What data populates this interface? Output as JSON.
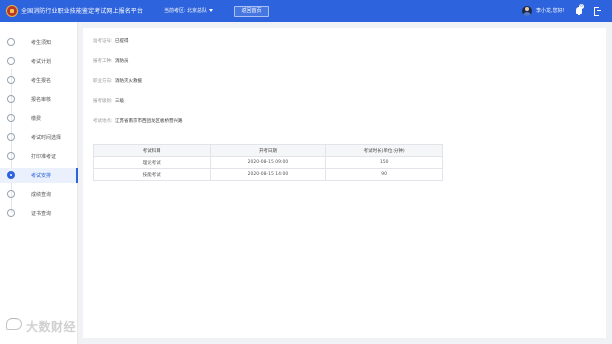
{
  "header": {
    "title": "全国消防行业职业技能鉴定考试网上报名平台",
    "region_label": "当前考区:",
    "region_value": "北京总队",
    "home_button": "返回首页",
    "greeting": "李小龙,您好!",
    "notification_count": "0",
    "brand_color": "#2d63dc"
  },
  "sidebar": {
    "active_index": 7,
    "items": [
      {
        "label": "考生须知",
        "icon": "info-icon"
      },
      {
        "label": "考试计划",
        "icon": "calendar-icon"
      },
      {
        "label": "考生报名",
        "icon": "register-icon"
      },
      {
        "label": "报名审核",
        "icon": "audit-icon"
      },
      {
        "label": "缴费",
        "icon": "payment-icon"
      },
      {
        "label": "考试时间选择",
        "icon": "clock-icon"
      },
      {
        "label": "打印准考证",
        "icon": "print-icon"
      },
      {
        "label": "考试安排",
        "icon": "schedule-icon"
      },
      {
        "label": "成绩查询",
        "icon": "score-icon"
      },
      {
        "label": "证书查询",
        "icon": "certificate-icon"
      }
    ]
  },
  "info": {
    "fields": [
      {
        "label": "准考证号:",
        "value": "已提得"
      },
      {
        "label": "报考工种:",
        "value": "消防员"
      },
      {
        "label": "职业方向:",
        "value": "消防灭火救援"
      },
      {
        "label": "报考级别:",
        "value": "三级"
      },
      {
        "label": "考试地点:",
        "value": "江苏省南京市西团龙区板桥营兴路"
      }
    ]
  },
  "schedule_table": {
    "headers": [
      "考试科目",
      "开考日期",
      "考试时长(单位:分钟)"
    ],
    "rows": [
      [
        "理论考试",
        "2020-08-15 09:00",
        "150"
      ],
      [
        "技能考试",
        "2020-08-15 14:00",
        "90"
      ]
    ]
  },
  "watermark": {
    "text": "大数财经"
  }
}
